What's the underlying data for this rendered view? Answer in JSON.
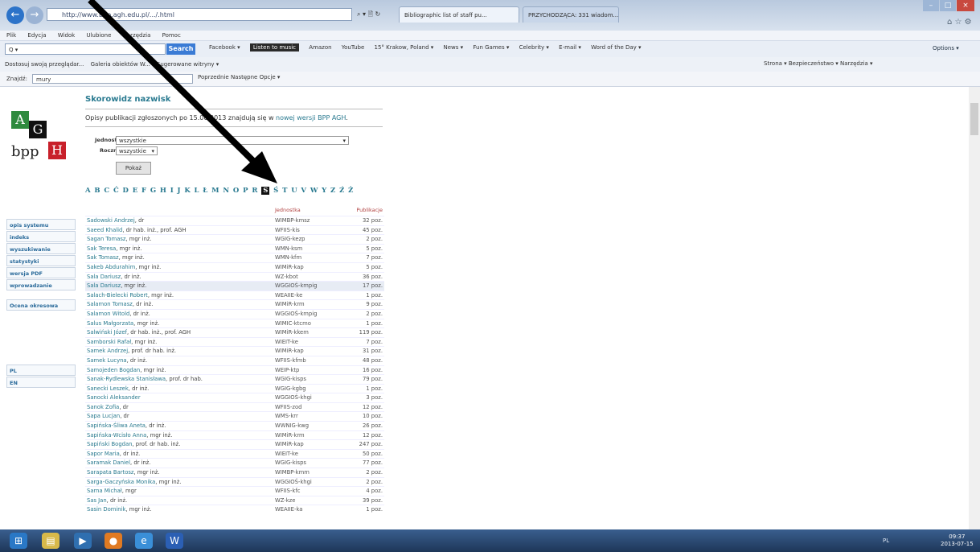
{
  "browser": {
    "address": "http://www.bpp.agh.edu.pl/.../.html",
    "address_controls": "⌕ ▾ 🗎 ↻",
    "tabs": [
      {
        "label": "Bibliographic list of staff pu..."
      },
      {
        "label": "PRZYCHODZĄCA: 331 wiadom..."
      }
    ],
    "menu": [
      "Plik",
      "Edycja",
      "Widok",
      "Ulubione",
      "Narzędzia",
      "Pomoc"
    ],
    "search_placeholder": "Q ▾",
    "search_button": "Search",
    "toolbar_items": [
      "Facebook ▾",
      "Listen to music",
      "Amazon",
      "YouTube",
      "15° Krakow, Poland ▾",
      "News ▾",
      "Fun Games ▾",
      "Celebrity ▾",
      "E-mail ▾",
      "Word of the Day ▾"
    ],
    "options": "Options ▾",
    "favorites_bar": [
      "Dostosuj swoją przeglądar...",
      "Galeria obiektów W...",
      "Sugerowane witryny ▾"
    ],
    "command_bar": "Strona ▾   Bezpieczeństwo ▾   Narzędzia ▾",
    "find_label": "Znajdź:",
    "find_value": "mury",
    "find_prev": "Poprzednie",
    "find_next": "Następne",
    "find_options": "Opcje ▾"
  },
  "sidebar": {
    "logo": {
      "a": "A",
      "g": "G",
      "bpp": "bpp",
      "h": "H"
    },
    "items": [
      "opis systemu",
      "indeks",
      "wyszukiwanie",
      "statystyki",
      "wersja PDF",
      "wprowadzanie"
    ],
    "extra": "Ocena okresowa",
    "languages": [
      "PL",
      "EN"
    ]
  },
  "main": {
    "title": "Skorowidz nazwisk",
    "note_before": "Opisy publikacji zgłoszonych po 15.06.2013 znajdują się w ",
    "note_link": "nowej wersji BPP AGH",
    "note_after": ".",
    "unit_label": "Jednostka",
    "unit_value": "wszystkie",
    "year_label": "Rocznik",
    "year_value": "wszystkie",
    "show_button": "Pokaż",
    "alphabet": [
      "A",
      "B",
      "C",
      "Ć",
      "D",
      "E",
      "F",
      "G",
      "H",
      "I",
      "J",
      "K",
      "L",
      "Ł",
      "M",
      "N",
      "O",
      "P",
      "R",
      "S",
      "Ś",
      "T",
      "U",
      "V",
      "W",
      "Y",
      "Z",
      "Ź",
      "Ż"
    ],
    "active_letter": "S",
    "col_unit": "Jednostka",
    "col_pub": "Publikacje",
    "rows": [
      {
        "name": "Sadowski Andrzej",
        "title": ", dr",
        "unit": "WIMBP-kmsz",
        "pub": "32 poz."
      },
      {
        "name": "Saeed Khalid",
        "title": ", dr hab. inż., prof. AGH",
        "unit": "WFIIS-kis",
        "pub": "45 poz."
      },
      {
        "name": "Sagan Tomasz",
        "title": ", mgr inż.",
        "unit": "WGIG-kezp",
        "pub": "2 poz."
      },
      {
        "name": "Sak Teresa",
        "title": ", mgr inż.",
        "unit": "WMN-ksm",
        "pub": "5 poz."
      },
      {
        "name": "Sak Tomasz",
        "title": ", mgr inż.",
        "unit": "WMN-kfm",
        "pub": "7 poz."
      },
      {
        "name": "Sakeb Abdurahim",
        "title": ", mgr inż.",
        "unit": "WIMiR-kap",
        "pub": "5 poz."
      },
      {
        "name": "Sala Dariusz",
        "title": ", dr inż.",
        "unit": "WZ-kbot",
        "pub": "36 poz."
      },
      {
        "name": "Sala Dariusz",
        "title": ", mgr inż.",
        "unit": "WGGIOŚ-kmpig",
        "pub": "17 poz."
      },
      {
        "name": "Salach-Bielecki Robert",
        "title": ", mgr inż.",
        "unit": "WEAIIE-ke",
        "pub": "1 poz."
      },
      {
        "name": "Salamon Tomasz",
        "title": ", dr inż.",
        "unit": "WIMiR-krm",
        "pub": "9 poz."
      },
      {
        "name": "Salamon Witold",
        "title": ", dr inż.",
        "unit": "WGGIOŚ-kmpig",
        "pub": "2 poz."
      },
      {
        "name": "Salus Małgorzata",
        "title": ", mgr inż.",
        "unit": "WIMIC-ktcmo",
        "pub": "1 poz."
      },
      {
        "name": "Salwiński Józef",
        "title": ", dr hab. inż., prof. AGH",
        "unit": "WIMiR-kkem",
        "pub": "119 poz."
      },
      {
        "name": "Samborski Rafał",
        "title": ", mgr inż.",
        "unit": "WIEIT-ke",
        "pub": "7 poz."
      },
      {
        "name": "Samek Andrzej",
        "title": ", prof. dr hab. inż.",
        "unit": "WIMiR-kap",
        "pub": "31 poz."
      },
      {
        "name": "Samek Lucyna",
        "title": ", dr inż.",
        "unit": "WFIIS-kfmb",
        "pub": "48 poz."
      },
      {
        "name": "Samojeden Bogdan",
        "title": ", mgr inż.",
        "unit": "WEIP-ktp",
        "pub": "16 poz."
      },
      {
        "name": "Sanak-Rydlewska Stanisława",
        "title": ", prof. dr hab.",
        "unit": "WGIG-kisps",
        "pub": "79 poz."
      },
      {
        "name": "Sanecki Leszek",
        "title": ", dr inż.",
        "unit": "WGIG-kgbg",
        "pub": "1 poz."
      },
      {
        "name": "Sanocki Aleksander",
        "title": "",
        "unit": "WGGIOŚ-khgi",
        "pub": "3 poz."
      },
      {
        "name": "Sanok Zofia",
        "title": ", dr",
        "unit": "WFIIS-zod",
        "pub": "12 poz."
      },
      {
        "name": "Sapa Lucjan",
        "title": ", dr",
        "unit": "WMS-krr",
        "pub": "10 poz."
      },
      {
        "name": "Sapińska-Śliwa Aneta",
        "title": ", dr inż.",
        "unit": "WWNIG-kwg",
        "pub": "26 poz."
      },
      {
        "name": "Sapińska-Wcisło Anna",
        "title": ", mgr inż.",
        "unit": "WIMiR-krm",
        "pub": "12 poz."
      },
      {
        "name": "Sapiński Bogdan",
        "title": ", prof. dr hab. inż.",
        "unit": "WIMiR-kap",
        "pub": "247 poz."
      },
      {
        "name": "Sapor Maria",
        "title": ", dr inż.",
        "unit": "WIEIT-ke",
        "pub": "50 poz."
      },
      {
        "name": "Saramak Daniel",
        "title": ", dr inż.",
        "unit": "WGIG-kisps",
        "pub": "77 poz."
      },
      {
        "name": "Sarapata Bartosz",
        "title": ", mgr inż.",
        "unit": "WIMBP-kmm",
        "pub": "2 poz."
      },
      {
        "name": "Sarga-Gaczyńska Monika",
        "title": ", mgr inż.",
        "unit": "WGGIOŚ-khgi",
        "pub": "2 poz."
      },
      {
        "name": "Sarna Michał",
        "title": ", mgr",
        "unit": "WFIIS-kfc",
        "pub": "4 poz."
      },
      {
        "name": "Sas Jan",
        "title": ", dr inż.",
        "unit": "WZ-kze",
        "pub": "39 poz."
      },
      {
        "name": "Sasin Dominik",
        "title": ", mgr inż.",
        "unit": "WEAIIE-ka",
        "pub": "1 poz."
      }
    ],
    "highlighted_row": 7
  },
  "taskbar": {
    "apps": [
      "Windows",
      "Explorer",
      "Media",
      "Firefox",
      "IE",
      "Word"
    ],
    "tray": "PL",
    "time": "09:37",
    "date": "2013-07-15"
  },
  "colors": {
    "accent": "#2a7a90",
    "header_red": "#b04040",
    "logo_green": "#2e8a3e",
    "logo_red": "#c8202a"
  }
}
